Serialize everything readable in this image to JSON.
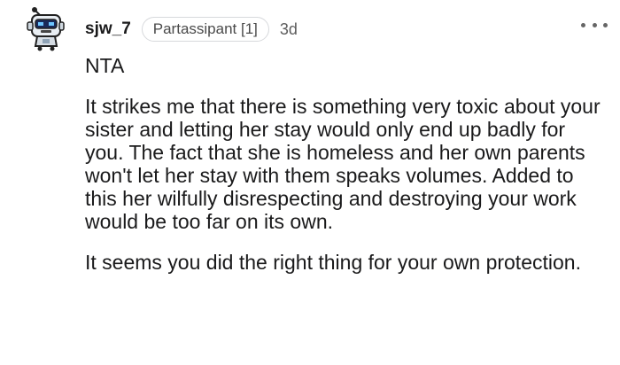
{
  "comment": {
    "author": "sjw_7",
    "flair": "Partassipant [1]",
    "timestamp": "3d",
    "avatar_icon": "robot-avatar-icon",
    "more_icon": "more-horizontal-icon",
    "verdict": "NTA",
    "paragraphs": [
      "It strikes me that there is something very toxic about your sister and letting her stay would only end up badly for you. The fact that she is homeless and her own parents won't let her stay with them speaks volumes. Added to this her wilfully disrespecting and destroying your work would be too far on its own.",
      "It seems you did the right thing for your own protection."
    ]
  }
}
